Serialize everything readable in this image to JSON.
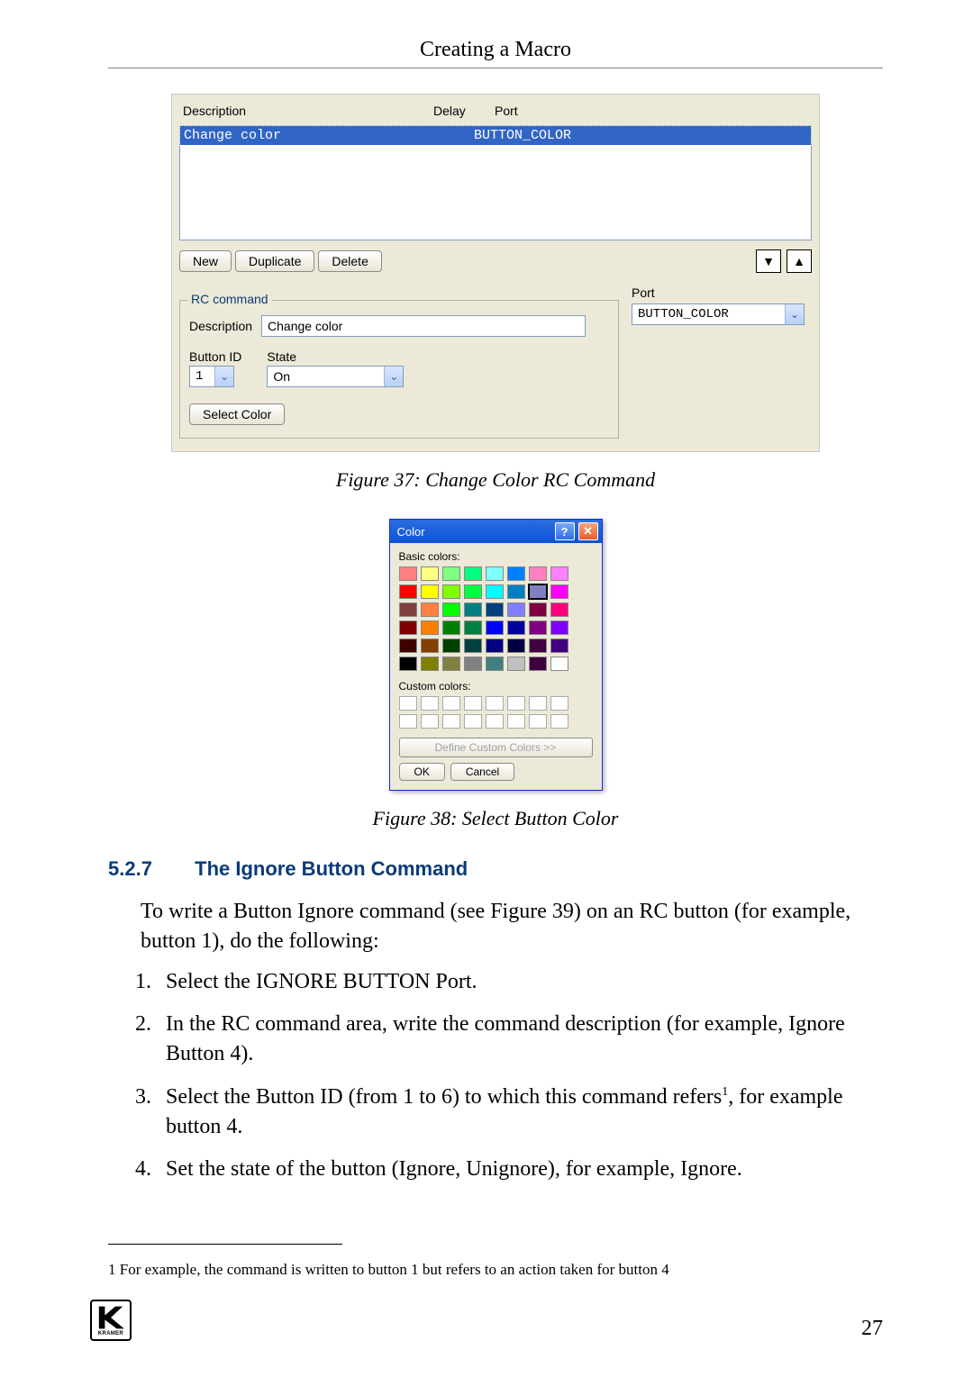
{
  "header": {
    "running_title": "Creating a Macro"
  },
  "fig37": {
    "columns": {
      "description": "Description",
      "delay": "Delay",
      "port": "Port"
    },
    "row": {
      "description": "Change color",
      "delay": "",
      "port": "BUTTON_COLOR"
    },
    "buttons": {
      "new": "New",
      "duplicate": "Duplicate",
      "delete": "Delete"
    },
    "arrows": {
      "down": "▼",
      "up": "▲"
    },
    "rc_legend": "RC command",
    "port_label": "Port",
    "port_value": "BUTTON_COLOR",
    "desc_label": "Description",
    "desc_value": "Change color",
    "button_id_label": "Button ID",
    "button_id_value": "1",
    "state_label": "State",
    "state_value": "On",
    "select_color_btn": "Select Color",
    "caption": "Figure 37: Change Color RC Command"
  },
  "fig38": {
    "title": "Color",
    "basic_label": "Basic colors:",
    "custom_label": "Custom colors:",
    "define_btn": "Define Custom Colors >>",
    "ok": "OK",
    "cancel": "Cancel",
    "caption": "Figure 38: Select Button Color",
    "basic_colors": [
      "#ff8080",
      "#ffff80",
      "#80ff80",
      "#00ff80",
      "#80ffff",
      "#0080ff",
      "#ff80c0",
      "#ff80ff",
      "#ff0000",
      "#ffff00",
      "#80ff00",
      "#00ff40",
      "#00ffff",
      "#0080c0",
      "#8080c0",
      "#ff00ff",
      "#804040",
      "#ff8040",
      "#00ff00",
      "#008080",
      "#004080",
      "#8080ff",
      "#800040",
      "#ff0080",
      "#800000",
      "#ff8000",
      "#008000",
      "#008040",
      "#0000ff",
      "#0000a0",
      "#800080",
      "#8000ff",
      "#400000",
      "#804000",
      "#004000",
      "#004040",
      "#000080",
      "#000040",
      "#400040",
      "#400080",
      "#000000",
      "#808000",
      "#808040",
      "#808080",
      "#408080",
      "#c0c0c0",
      "#400040",
      "#ffffff"
    ],
    "selected_index": 14
  },
  "section": {
    "number": "5.2.7",
    "title": "The Ignore Button Command",
    "intro": "To write a Button Ignore command (see Figure 39) on an RC button (for example, button 1), do the following:",
    "steps": [
      "Select the IGNORE BUTTON Port.",
      "In the RC command area, write the command description (for example, Ignore Button 4).",
      "Select the Button ID (from 1 to 6) to which this command refers",
      "Set the state of the button (Ignore, Unignore), for example, Ignore."
    ],
    "step3_tail": ", for example button 4.",
    "footnote_marker": "1",
    "footnote": "1 For example, the command is written to button 1 but refers to an action taken for button 4"
  },
  "footer": {
    "page": "27",
    "brand": "KRAMER"
  }
}
